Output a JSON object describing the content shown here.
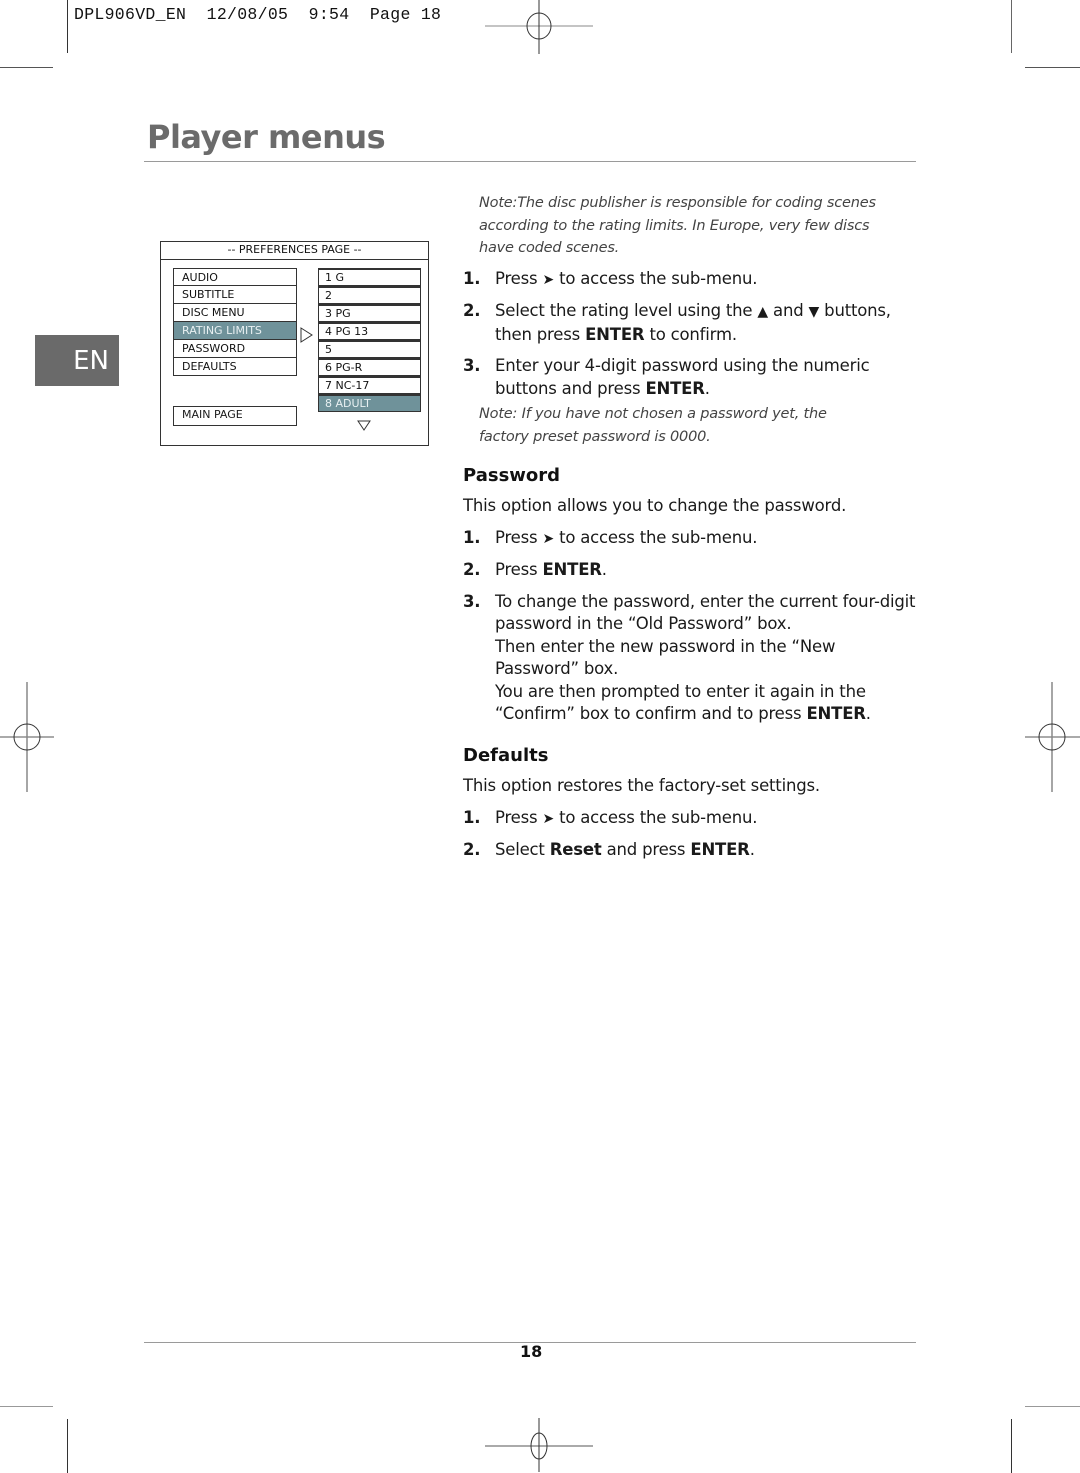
{
  "header": {
    "slug": "DPL906VD_EN  12/08/05  9:54  Page 18"
  },
  "title": "Player menus",
  "language_tab": "EN",
  "osd": {
    "heading": "-- PREFERENCES PAGE --",
    "menu_items": [
      {
        "label": "AUDIO",
        "selected": false
      },
      {
        "label": "SUBTITLE",
        "selected": false
      },
      {
        "label": "DISC MENU",
        "selected": false
      },
      {
        "label": "RATING LIMITS",
        "selected": true
      },
      {
        "label": "PASSWORD",
        "selected": false
      },
      {
        "label": "DEFAULTS",
        "selected": false
      }
    ],
    "main_page": "MAIN PAGE",
    "ratings": [
      {
        "label": "1 G",
        "selected": false
      },
      {
        "label": "2",
        "selected": false
      },
      {
        "label": "3 PG",
        "selected": false
      },
      {
        "label": "4 PG 13",
        "selected": false
      },
      {
        "label": "5",
        "selected": false
      },
      {
        "label": "6 PG-R",
        "selected": false
      },
      {
        "label": "7 NC-17",
        "selected": false
      },
      {
        "label": "8 ADULT",
        "selected": true
      }
    ],
    "highlight_color": "#6f929a"
  },
  "rating_section": {
    "note_top": "Note:The disc publisher is responsible for coding scenes according to the rating limits. In Europe, very few discs have coded scenes.",
    "steps": [
      {
        "num": "1.",
        "pre": "Press",
        "icon": "right-arrow",
        "post": "to access the sub-menu."
      },
      {
        "num": "2.",
        "text_a": "Select the rating level using the",
        "and": "and",
        "text_b": "buttons, then press",
        "bold": "ENTER",
        "text_c": "to confirm."
      },
      {
        "num": "3.",
        "text_a": "Enter your 4-digit password using the numeric buttons and press",
        "bold": "ENTER",
        "text_c": "."
      }
    ],
    "note_bottom": "Note: If you have not chosen a password yet, the factory preset password is 0000."
  },
  "password_section": {
    "heading": "Password",
    "intro": "This option allows you to change the password.",
    "step1": {
      "num": "1.",
      "pre": "Press",
      "post": "to access the sub-menu."
    },
    "step2": {
      "num": "2.",
      "pre": "Press",
      "bold": "ENTER",
      "post": "."
    },
    "step3": {
      "num": "3.",
      "line_a": "To change the password, enter the current four-digit password in the “Old Password” box.",
      "line_b": "Then enter the new password in the “New Password” box.",
      "line_c": "You are then prompted to enter it again in the “Confirm” box to confirm and to press",
      "bold": "ENTER",
      "end": "."
    }
  },
  "defaults_section": {
    "heading": "Defaults",
    "intro": "This option restores the factory-set settings.",
    "step1": {
      "num": "1.",
      "pre": "Press",
      "post": "to access the sub-menu."
    },
    "step2": {
      "num": "2.",
      "pre": "Select",
      "bold1": "Reset",
      "mid": "and press",
      "bold2": "ENTER",
      "post": "."
    }
  },
  "footer": {
    "page_number": "18"
  }
}
